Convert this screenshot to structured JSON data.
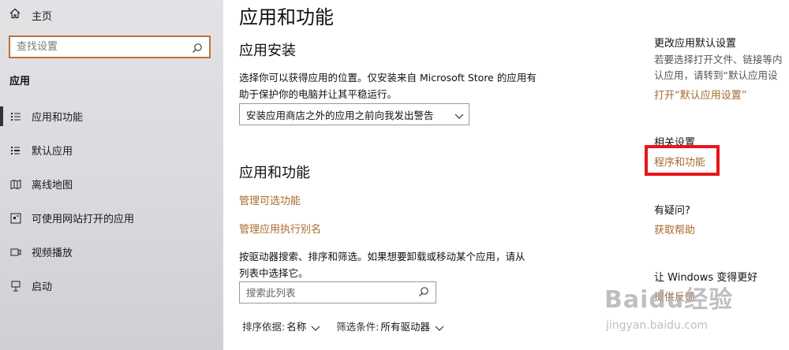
{
  "sidebar": {
    "home_label": "主页",
    "search_placeholder": "查找设置",
    "section_label": "应用",
    "items": [
      {
        "label": "应用和功能"
      },
      {
        "label": "默认应用"
      },
      {
        "label": "离线地图"
      },
      {
        "label": "可使用网站打开的应用"
      },
      {
        "label": "视频播放"
      },
      {
        "label": "启动"
      }
    ]
  },
  "main": {
    "title": "应用和功能",
    "install_heading": "应用安装",
    "install_desc_line1": "选择你可以获得应用的位置。仅安装来自 Microsoft Store 的应用有",
    "install_desc_line2": "助于保护你的电脑并让其平稳运行。",
    "install_dropdown_value": "安装应用商店之外的应用之前向我发出警告",
    "apps_heading": "应用和功能",
    "link_optional_features": "管理可选功能",
    "link_app_aliases": "管理应用执行别名",
    "search_desc_line1": "按驱动器搜索、排序和筛选。如果想要卸载或移动某个应用，请从",
    "search_desc_line2": "列表中选择它。",
    "list_search_placeholder": "搜索此列表",
    "sort_label": "排序依据:",
    "sort_value": "名称",
    "filter_label": "筛选条件:",
    "filter_value": "所有驱动器"
  },
  "right": {
    "default_apps_title": "更改应用默认设置",
    "default_apps_text_line1": "若要选择打开文件、链接等内",
    "default_apps_text_line2": "认应用，请转到“默认应用设",
    "default_apps_link": "打开“默认应用设置”",
    "related_title": "相关设置",
    "programs_link": "程序和功能",
    "question_title": "有疑问?",
    "help_link": "获取帮助",
    "better_title": "让 Windows 变得更好",
    "feedback_link": "提供反馈"
  },
  "watermark": {
    "logo": "Baidu经验",
    "sub": "jingyan.baidu.com"
  },
  "colors": {
    "accent": "#a86a2e",
    "highlight": "#e8141b",
    "sidebar_bg": "#dcdce0"
  }
}
